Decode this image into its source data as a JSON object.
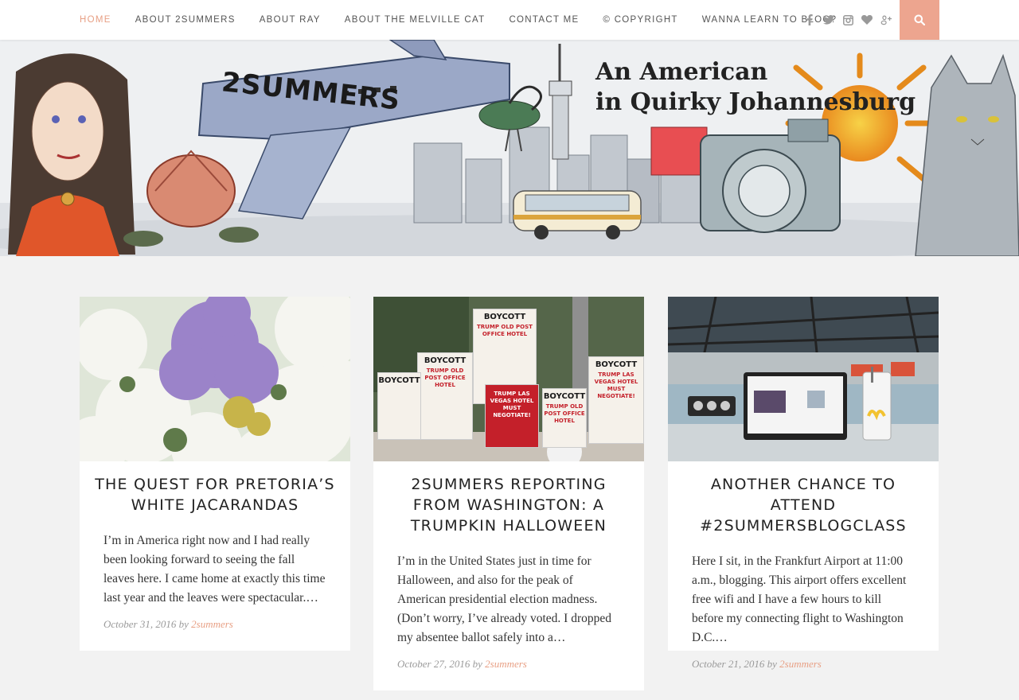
{
  "nav": {
    "items": [
      "HOME",
      "ABOUT 2SUMMERS",
      "ABOUT RAY",
      "ABOUT THE MELVILLE CAT",
      "CONTACT ME",
      "© COPYRIGHT",
      "WANNA LEARN TO BLOG?"
    ],
    "active_index": 0,
    "social_icons": [
      "facebook-icon",
      "twitter-icon",
      "instagram-icon",
      "bloglovin-heart-icon",
      "google-plus-icon"
    ],
    "search_icon": "search-icon",
    "accent_color": "#eda58f"
  },
  "banner": {
    "plane_text": "2SUMMERS",
    "title_line1": "An American",
    "title_line2": "in Quirky Johannesburg"
  },
  "posts": [
    {
      "title": "THE QUEST FOR PRETORIA’S WHITE JACARANDAS",
      "excerpt": "I’m in America right now and I had really been looking forward to seeing the fall leaves here. I came home at exactly this time last year and the leaves were spectacular.…",
      "date": "October 31, 2016",
      "by": "by",
      "author": "2summers",
      "image": "jacaranda-trees"
    },
    {
      "title": "2SUMMERS REPORTING FROM WASHINGTON: A TRUMPKIN HALLOWEEN",
      "excerpt": "I’m in the United States just in time for Halloween, and also for the peak of American presidential election madness. (Don’t worry, I’ve already voted. I dropped my absentee ballot safely into a…",
      "date": "October 27, 2016",
      "by": "by",
      "author": "2summers",
      "image": "boycott-protest-signs",
      "sign_text": {
        "boycott": "BOYCOTT",
        "sub1": "TRUMP OLD POST OFFICE HOTEL",
        "sub2": "TRUMP LAS VEGAS HOTEL MUST NEGOTIATE!"
      }
    },
    {
      "title": "ANOTHER CHANCE TO ATTEND #2SUMMERSBLOGCLASS",
      "excerpt": "Here I sit, in the Frankfurt Airport at 11:00 a.m., blogging. This airport offers excellent free wifi and I have a few hours to kill before my connecting flight to Washington D.C.…",
      "date": "October 21, 2016",
      "by": "by",
      "author": "2summers",
      "image": "laptop-in-airport"
    }
  ]
}
